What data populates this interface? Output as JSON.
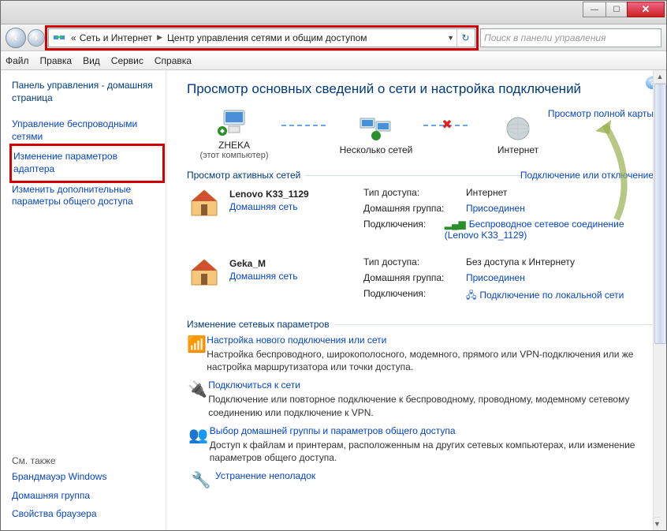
{
  "titlebar": {
    "min": "—",
    "max": "☐",
    "close": "✕"
  },
  "nav": {
    "back_arrow": "‹",
    "fwd_arrow": "›",
    "chevrons": "«",
    "crumb1": "Сеть и Интернет",
    "crumb2": "Центр управления сетями и общим доступом",
    "refresh": "↻",
    "search_placeholder": "Поиск в панели управления"
  },
  "menubar": [
    "Файл",
    "Правка",
    "Вид",
    "Сервис",
    "Справка"
  ],
  "sidebar": {
    "home": "Панель управления - домашняя страница",
    "wireless": "Управление беспроводными сетями",
    "adapter": "Изменение параметров адаптера",
    "sharing": "Изменить дополнительные параметры общего доступа",
    "see_also": "См. также",
    "firewall": "Брандмауэр Windows",
    "homegroup": "Домашняя группа",
    "browser": "Свойства браузера"
  },
  "main": {
    "title": "Просмотр основных сведений о сети и настройка подключений",
    "full_map": "Просмотр полной карты",
    "map": {
      "this_pc": "ZHEKA",
      "this_pc_sub": "(этот компьютер)",
      "multi": "Несколько сетей",
      "internet": "Интернет"
    },
    "active_header": "Просмотр активных сетей",
    "connect_link": "Подключение или отключение",
    "labels": {
      "access": "Тип доступа:",
      "homegroup": "Домашняя группа:",
      "conn": "Подключения:"
    },
    "net1": {
      "name": "Lenovo K33_1129",
      "type": "Домашняя сеть",
      "access": "Интернет",
      "homegroup": "Присоединен",
      "conn": "Беспроводное сетевое соединение (Lenovo K33_1129)"
    },
    "net2": {
      "name": "Geka_M",
      "type": "Домашняя сеть",
      "access": "Без доступа к Интернету",
      "homegroup": "Присоединен",
      "conn": "Подключение по локальной сети"
    },
    "settings_header": "Изменение сетевых параметров",
    "tasks": [
      {
        "title": "Настройка нового подключения или сети",
        "desc": "Настройка беспроводного, широкополосного, модемного, прямого или VPN-подключения или же настройка маршрутизатора или точки доступа."
      },
      {
        "title": "Подключиться к сети",
        "desc": "Подключение или повторное подключение к беспроводному, проводному, модемному сетевому соединению или подключение к VPN."
      },
      {
        "title": "Выбор домашней группы и параметров общего доступа",
        "desc": "Доступ к файлам и принтерам, расположенным на других сетевых компьютерах, или изменение параметров общего доступа."
      },
      {
        "title": "Устранение неполадок",
        "desc": ""
      }
    ]
  }
}
